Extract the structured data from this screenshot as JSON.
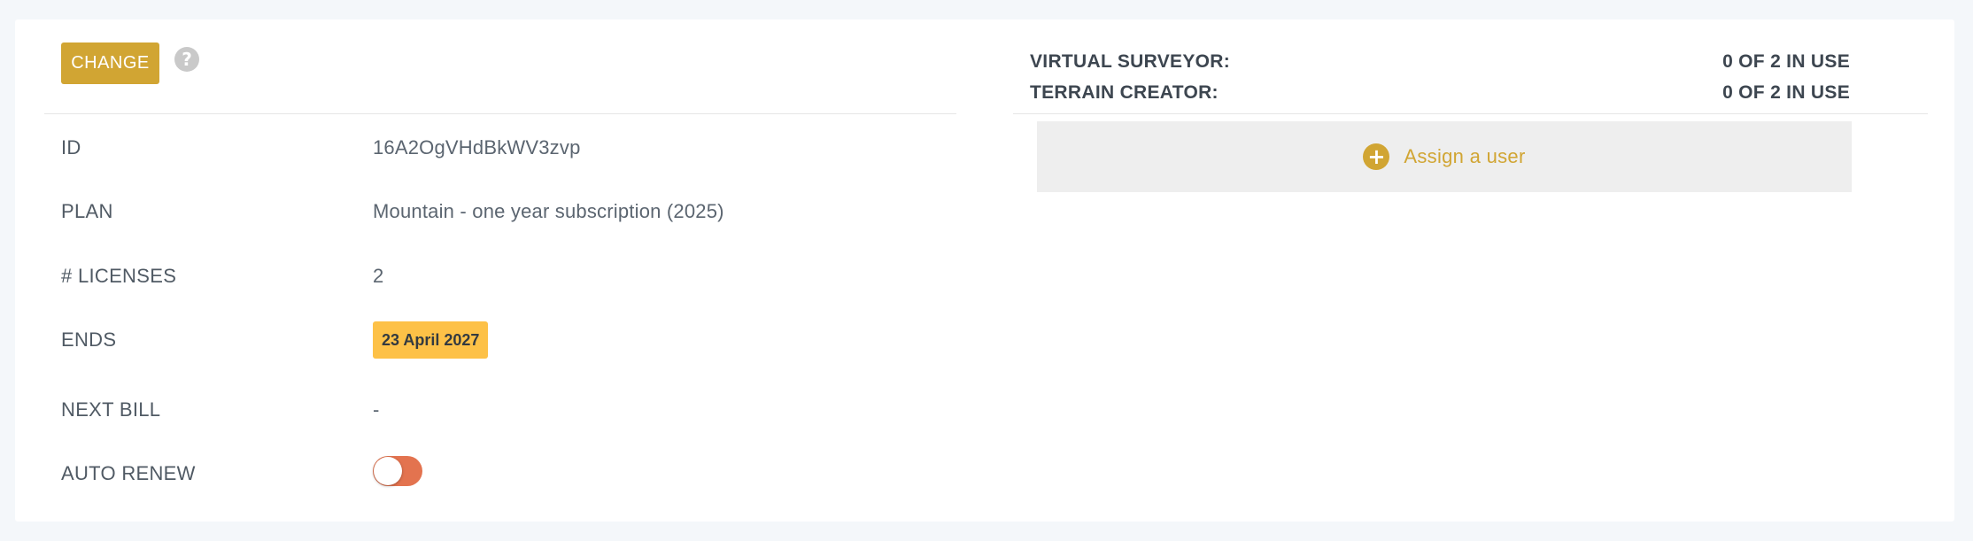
{
  "toolbar": {
    "change_label": "CHANGE",
    "help_icon": "question-circle-icon",
    "help_glyph": "?"
  },
  "subscription": {
    "rows": [
      {
        "label": "ID",
        "value": "16A2OgVHdBkWV3zvp"
      },
      {
        "label": "PLAN",
        "value": "Mountain - one year subscription (2025)"
      },
      {
        "label": "# LICENSES",
        "value": "2"
      },
      {
        "label": "ENDS",
        "value": "23 April 2027"
      },
      {
        "label": "NEXT BILL",
        "value": "-"
      },
      {
        "label": "AUTO RENEW",
        "value": "off"
      }
    ]
  },
  "usage": {
    "items": [
      {
        "label": "VIRTUAL SURVEYOR:",
        "value": "0 OF 2 IN USE"
      },
      {
        "label": "TERRAIN CREATOR:",
        "value": "0 OF 2 IN USE"
      }
    ],
    "assign_label": "Assign a user",
    "assign_icon": "plus-circle-icon",
    "plus_glyph": "+"
  },
  "colors": {
    "accent": "#d1a533",
    "badge": "#fdc147",
    "toggle_off": "#e3734f",
    "background": "#f4f7fa"
  }
}
